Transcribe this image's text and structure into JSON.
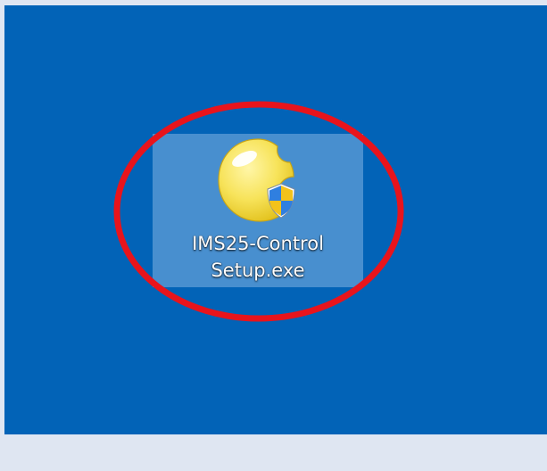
{
  "desktop": {
    "background_color": "#0263b7",
    "icon": {
      "label_line1": "IMS25-Control",
      "label_line2": "Setup.exe",
      "icon_name": "app-installer-icon",
      "overlay_icon_name": "uac-shield-icon",
      "selected": true
    }
  },
  "annotation": {
    "shape": "ellipse",
    "color": "#e8141c"
  }
}
